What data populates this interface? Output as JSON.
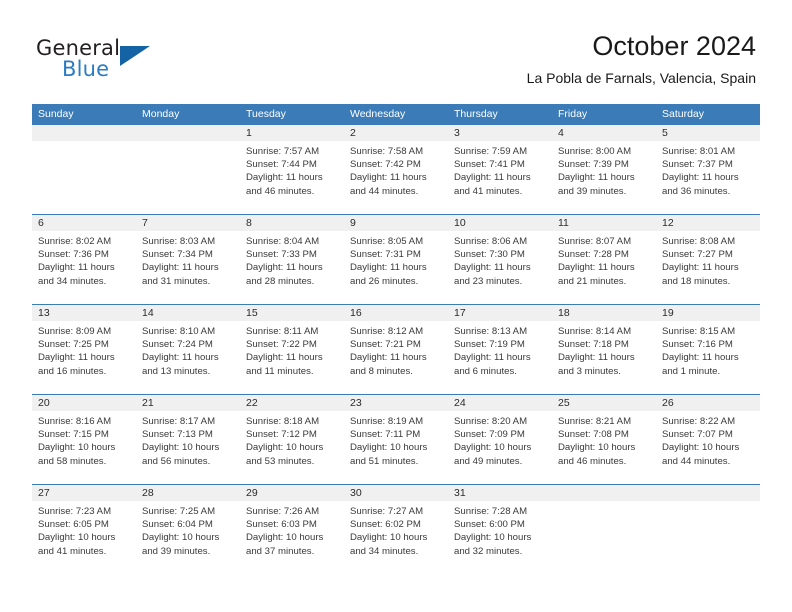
{
  "brand": {
    "name_primary": "General",
    "name_secondary": "Blue",
    "triangle_icon": "triangle-icon",
    "accent_color": "#1464a5",
    "secondary_color": "#2b7cc4"
  },
  "header": {
    "title": "October 2024",
    "subtitle": "La Pobla de Farnals, Valencia, Spain"
  },
  "calendar": {
    "header_color": "#3b7cb8",
    "daynumber_band_color": "#f0f0f0",
    "weekdays": [
      "Sunday",
      "Monday",
      "Tuesday",
      "Wednesday",
      "Thursday",
      "Friday",
      "Saturday"
    ],
    "weeks": [
      [
        {
          "day": "",
          "empty": true,
          "sunrise": "",
          "sunset": "",
          "daylight_line1": "",
          "daylight_line2": ""
        },
        {
          "day": "",
          "empty": true,
          "sunrise": "",
          "sunset": "",
          "daylight_line1": "",
          "daylight_line2": ""
        },
        {
          "day": "1",
          "empty": false,
          "sunrise": "Sunrise: 7:57 AM",
          "sunset": "Sunset: 7:44 PM",
          "daylight_line1": "Daylight: 11 hours",
          "daylight_line2": "and 46 minutes."
        },
        {
          "day": "2",
          "empty": false,
          "sunrise": "Sunrise: 7:58 AM",
          "sunset": "Sunset: 7:42 PM",
          "daylight_line1": "Daylight: 11 hours",
          "daylight_line2": "and 44 minutes."
        },
        {
          "day": "3",
          "empty": false,
          "sunrise": "Sunrise: 7:59 AM",
          "sunset": "Sunset: 7:41 PM",
          "daylight_line1": "Daylight: 11 hours",
          "daylight_line2": "and 41 minutes."
        },
        {
          "day": "4",
          "empty": false,
          "sunrise": "Sunrise: 8:00 AM",
          "sunset": "Sunset: 7:39 PM",
          "daylight_line1": "Daylight: 11 hours",
          "daylight_line2": "and 39 minutes."
        },
        {
          "day": "5",
          "empty": false,
          "sunrise": "Sunrise: 8:01 AM",
          "sunset": "Sunset: 7:37 PM",
          "daylight_line1": "Daylight: 11 hours",
          "daylight_line2": "and 36 minutes."
        }
      ],
      [
        {
          "day": "6",
          "empty": false,
          "sunrise": "Sunrise: 8:02 AM",
          "sunset": "Sunset: 7:36 PM",
          "daylight_line1": "Daylight: 11 hours",
          "daylight_line2": "and 34 minutes."
        },
        {
          "day": "7",
          "empty": false,
          "sunrise": "Sunrise: 8:03 AM",
          "sunset": "Sunset: 7:34 PM",
          "daylight_line1": "Daylight: 11 hours",
          "daylight_line2": "and 31 minutes."
        },
        {
          "day": "8",
          "empty": false,
          "sunrise": "Sunrise: 8:04 AM",
          "sunset": "Sunset: 7:33 PM",
          "daylight_line1": "Daylight: 11 hours",
          "daylight_line2": "and 28 minutes."
        },
        {
          "day": "9",
          "empty": false,
          "sunrise": "Sunrise: 8:05 AM",
          "sunset": "Sunset: 7:31 PM",
          "daylight_line1": "Daylight: 11 hours",
          "daylight_line2": "and 26 minutes."
        },
        {
          "day": "10",
          "empty": false,
          "sunrise": "Sunrise: 8:06 AM",
          "sunset": "Sunset: 7:30 PM",
          "daylight_line1": "Daylight: 11 hours",
          "daylight_line2": "and 23 minutes."
        },
        {
          "day": "11",
          "empty": false,
          "sunrise": "Sunrise: 8:07 AM",
          "sunset": "Sunset: 7:28 PM",
          "daylight_line1": "Daylight: 11 hours",
          "daylight_line2": "and 21 minutes."
        },
        {
          "day": "12",
          "empty": false,
          "sunrise": "Sunrise: 8:08 AM",
          "sunset": "Sunset: 7:27 PM",
          "daylight_line1": "Daylight: 11 hours",
          "daylight_line2": "and 18 minutes."
        }
      ],
      [
        {
          "day": "13",
          "empty": false,
          "sunrise": "Sunrise: 8:09 AM",
          "sunset": "Sunset: 7:25 PM",
          "daylight_line1": "Daylight: 11 hours",
          "daylight_line2": "and 16 minutes."
        },
        {
          "day": "14",
          "empty": false,
          "sunrise": "Sunrise: 8:10 AM",
          "sunset": "Sunset: 7:24 PM",
          "daylight_line1": "Daylight: 11 hours",
          "daylight_line2": "and 13 minutes."
        },
        {
          "day": "15",
          "empty": false,
          "sunrise": "Sunrise: 8:11 AM",
          "sunset": "Sunset: 7:22 PM",
          "daylight_line1": "Daylight: 11 hours",
          "daylight_line2": "and 11 minutes."
        },
        {
          "day": "16",
          "empty": false,
          "sunrise": "Sunrise: 8:12 AM",
          "sunset": "Sunset: 7:21 PM",
          "daylight_line1": "Daylight: 11 hours",
          "daylight_line2": "and 8 minutes."
        },
        {
          "day": "17",
          "empty": false,
          "sunrise": "Sunrise: 8:13 AM",
          "sunset": "Sunset: 7:19 PM",
          "daylight_line1": "Daylight: 11 hours",
          "daylight_line2": "and 6 minutes."
        },
        {
          "day": "18",
          "empty": false,
          "sunrise": "Sunrise: 8:14 AM",
          "sunset": "Sunset: 7:18 PM",
          "daylight_line1": "Daylight: 11 hours",
          "daylight_line2": "and 3 minutes."
        },
        {
          "day": "19",
          "empty": false,
          "sunrise": "Sunrise: 8:15 AM",
          "sunset": "Sunset: 7:16 PM",
          "daylight_line1": "Daylight: 11 hours",
          "daylight_line2": "and 1 minute."
        }
      ],
      [
        {
          "day": "20",
          "empty": false,
          "sunrise": "Sunrise: 8:16 AM",
          "sunset": "Sunset: 7:15 PM",
          "daylight_line1": "Daylight: 10 hours",
          "daylight_line2": "and 58 minutes."
        },
        {
          "day": "21",
          "empty": false,
          "sunrise": "Sunrise: 8:17 AM",
          "sunset": "Sunset: 7:13 PM",
          "daylight_line1": "Daylight: 10 hours",
          "daylight_line2": "and 56 minutes."
        },
        {
          "day": "22",
          "empty": false,
          "sunrise": "Sunrise: 8:18 AM",
          "sunset": "Sunset: 7:12 PM",
          "daylight_line1": "Daylight: 10 hours",
          "daylight_line2": "and 53 minutes."
        },
        {
          "day": "23",
          "empty": false,
          "sunrise": "Sunrise: 8:19 AM",
          "sunset": "Sunset: 7:11 PM",
          "daylight_line1": "Daylight: 10 hours",
          "daylight_line2": "and 51 minutes."
        },
        {
          "day": "24",
          "empty": false,
          "sunrise": "Sunrise: 8:20 AM",
          "sunset": "Sunset: 7:09 PM",
          "daylight_line1": "Daylight: 10 hours",
          "daylight_line2": "and 49 minutes."
        },
        {
          "day": "25",
          "empty": false,
          "sunrise": "Sunrise: 8:21 AM",
          "sunset": "Sunset: 7:08 PM",
          "daylight_line1": "Daylight: 10 hours",
          "daylight_line2": "and 46 minutes."
        },
        {
          "day": "26",
          "empty": false,
          "sunrise": "Sunrise: 8:22 AM",
          "sunset": "Sunset: 7:07 PM",
          "daylight_line1": "Daylight: 10 hours",
          "daylight_line2": "and 44 minutes."
        }
      ],
      [
        {
          "day": "27",
          "empty": false,
          "sunrise": "Sunrise: 7:23 AM",
          "sunset": "Sunset: 6:05 PM",
          "daylight_line1": "Daylight: 10 hours",
          "daylight_line2": "and 41 minutes."
        },
        {
          "day": "28",
          "empty": false,
          "sunrise": "Sunrise: 7:25 AM",
          "sunset": "Sunset: 6:04 PM",
          "daylight_line1": "Daylight: 10 hours",
          "daylight_line2": "and 39 minutes."
        },
        {
          "day": "29",
          "empty": false,
          "sunrise": "Sunrise: 7:26 AM",
          "sunset": "Sunset: 6:03 PM",
          "daylight_line1": "Daylight: 10 hours",
          "daylight_line2": "and 37 minutes."
        },
        {
          "day": "30",
          "empty": false,
          "sunrise": "Sunrise: 7:27 AM",
          "sunset": "Sunset: 6:02 PM",
          "daylight_line1": "Daylight: 10 hours",
          "daylight_line2": "and 34 minutes."
        },
        {
          "day": "31",
          "empty": false,
          "sunrise": "Sunrise: 7:28 AM",
          "sunset": "Sunset: 6:00 PM",
          "daylight_line1": "Daylight: 10 hours",
          "daylight_line2": "and 32 minutes."
        },
        {
          "day": "",
          "empty": true,
          "sunrise": "",
          "sunset": "",
          "daylight_line1": "",
          "daylight_line2": ""
        },
        {
          "day": "",
          "empty": true,
          "sunrise": "",
          "sunset": "",
          "daylight_line1": "",
          "daylight_line2": ""
        }
      ]
    ]
  }
}
